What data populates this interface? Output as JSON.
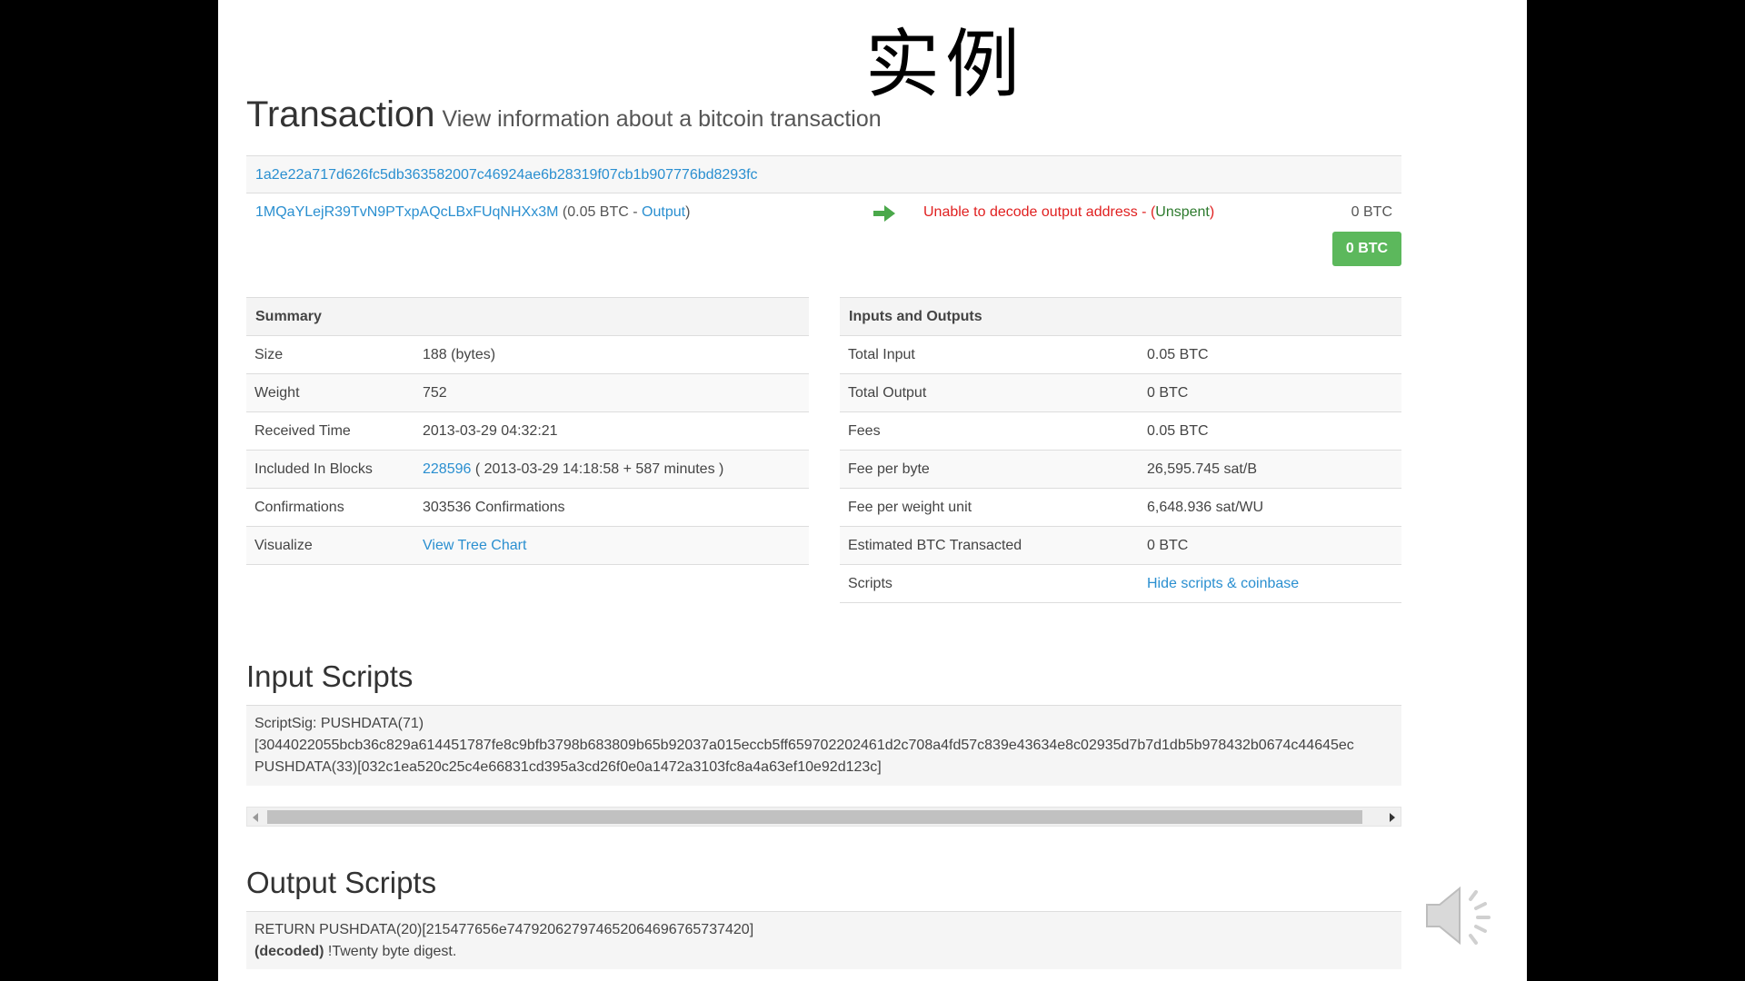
{
  "slide_title": "实例",
  "heading": {
    "title": "Transaction",
    "subtitle": "View information about a bitcoin transaction"
  },
  "tx": {
    "hash": "1a2e22a717d626fc5db363582007c46924ae6b28319f07cb1b907776bd8293fc",
    "input_address": "1MQaYLejR39TvN9PTxpAQcLBxFUqNHXx3M",
    "input_amount_prefix": "(0.05 BTC - ",
    "input_output_link": "Output",
    "input_amount_suffix": ")",
    "output_message": "Unable to decode output address",
    "output_status_prefix": " - (",
    "output_status": "Unspent",
    "output_status_suffix": ")",
    "output_amount": "0 BTC",
    "total_badge": "0 BTC"
  },
  "summary": {
    "header": "Summary",
    "rows": [
      {
        "key": "Size",
        "value": "188 (bytes)"
      },
      {
        "key": "Weight",
        "value": "752"
      },
      {
        "key": "Received Time",
        "value": "2013-03-29 04:32:21"
      },
      {
        "key": "Included In Blocks",
        "block_link": "228596",
        "value": " ( 2013-03-29 14:18:58 + 587 minutes )"
      },
      {
        "key": "Confirmations",
        "value": "303536 Confirmations"
      },
      {
        "key": "Visualize",
        "link": "View Tree Chart"
      }
    ]
  },
  "inputs_outputs": {
    "header": "Inputs and Outputs",
    "rows": [
      {
        "key": "Total Input",
        "value": "0.05 BTC"
      },
      {
        "key": "Total Output",
        "value": "0 BTC"
      },
      {
        "key": "Fees",
        "value": "0.05 BTC"
      },
      {
        "key": "Fee per byte",
        "value": "26,595.745 sat/B"
      },
      {
        "key": "Fee per weight unit",
        "value": "6,648.936 sat/WU"
      },
      {
        "key": "Estimated BTC Transacted",
        "value": "0 BTC"
      },
      {
        "key": "Scripts",
        "link": "Hide scripts & coinbase"
      }
    ]
  },
  "input_scripts": {
    "title": "Input Scripts",
    "lines": [
      "ScriptSig: PUSHDATA(71)",
      "[3044022055bcb36c829a614451787fe8c9bfb3798b683809b65b92037a015eccb5ff659702202461d2c708a4fd57c839e43634e8c02935d7b7d1db5b978432b0674c44645ec",
      "PUSHDATA(33)[032c1ea520c25c4e66831cd395a3cd26f0e0a1472a3103fc8a4a63ef10e92d123c]"
    ]
  },
  "output_scripts": {
    "title": "Output Scripts",
    "line1": "RETURN PUSHDATA(20)[215477656e747920627974652064696765737420]",
    "decoded_label": "(decoded)",
    "decoded_text": " !Twenty byte digest."
  },
  "icons": {
    "arrow": "arrow-right-icon",
    "speaker": "speaker-icon"
  },
  "colors": {
    "link": "#2a8fd0",
    "badge": "#5cb85c",
    "unspent": "#2d7a2d",
    "error": "#e02020"
  }
}
